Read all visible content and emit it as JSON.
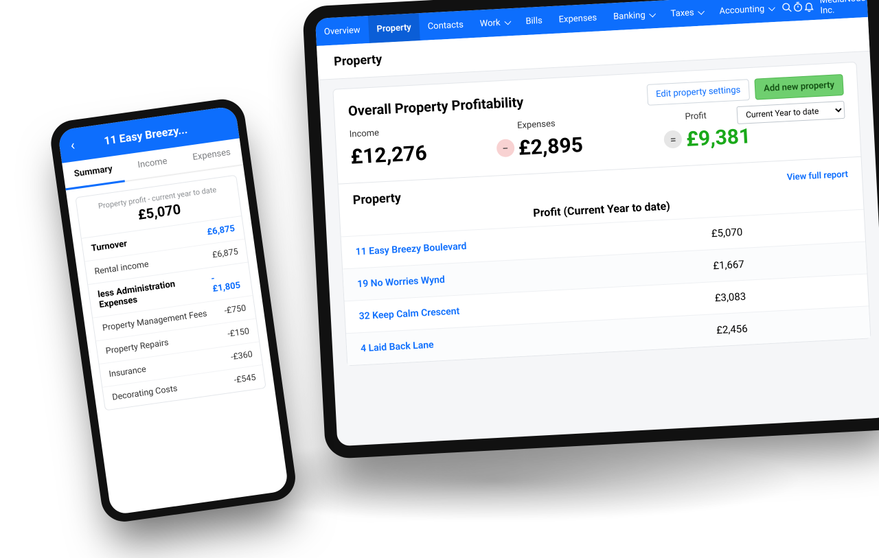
{
  "tablet": {
    "nav": {
      "overview": "Overview",
      "property": "Property",
      "contacts": "Contacts",
      "work": "Work",
      "bills": "Bills",
      "expenses": "Expenses",
      "banking": "Banking",
      "taxes": "Taxes",
      "accounting": "Accounting"
    },
    "company": "MediaNode Inc.",
    "page_title": "Property",
    "panel": {
      "heading": "Overall Property Profitability",
      "edit_btn": "Edit property settings",
      "add_btn": "Add new property",
      "income_label": "Income",
      "income_value": "£12,276",
      "expenses_label": "Expenses",
      "expenses_value": "£2,895",
      "profit_label": "Profit",
      "profit_value": "£9,381",
      "period_option": "Current Year to date",
      "list_heading": "Property",
      "view_report": "View full report",
      "profit_col": "Profit (Current Year to date)",
      "rows": [
        {
          "name": "11 Easy Breezy Boulevard",
          "amount": "£5,070"
        },
        {
          "name": "19 No Worries Wynd",
          "amount": "£1,667"
        },
        {
          "name": "32 Keep Calm Crescent",
          "amount": "£3,083"
        },
        {
          "name": "4 Laid Back Lane",
          "amount": "£2,456"
        }
      ]
    }
  },
  "phone": {
    "title": "11 Easy Breezy...",
    "tabs": {
      "summary": "Summary",
      "income": "Income",
      "expenses": "Expenses"
    },
    "caption": "Property profit - current year to date",
    "total": "£5,070",
    "turnover": {
      "label": "Turnover",
      "value": "£6,875"
    },
    "rental": {
      "label": "Rental income",
      "value": "£6,875"
    },
    "admin_head": {
      "label": "less Administration Expenses",
      "value": "-£1,805"
    },
    "lines": [
      {
        "label": "Property Management Fees",
        "value": "-£750"
      },
      {
        "label": "Property Repairs",
        "value": "-£150"
      },
      {
        "label": "Insurance",
        "value": "-£360"
      },
      {
        "label": "Decorating Costs",
        "value": "-£545"
      }
    ]
  }
}
